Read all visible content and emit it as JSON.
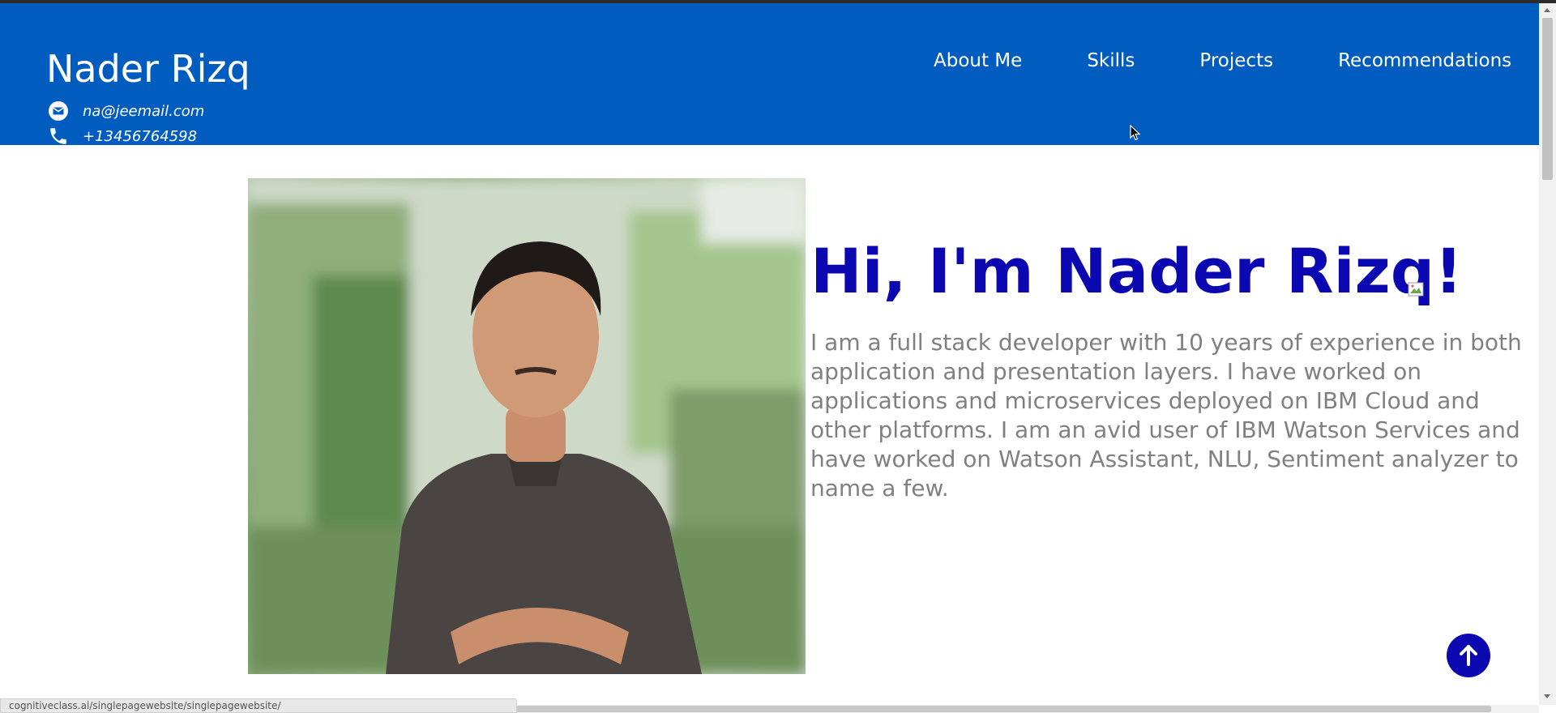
{
  "header": {
    "name": "Nader Rizq",
    "email": "na@jeemail.com",
    "phone": "+13456764598",
    "background_color": "#005cbf"
  },
  "nav": {
    "items": [
      {
        "label": "About Me"
      },
      {
        "label": "Skills"
      },
      {
        "label": "Projects"
      },
      {
        "label": "Recommendations"
      }
    ]
  },
  "hero": {
    "title": "Hi, I'm Nader Rizq!",
    "title_color": "#0b08b2",
    "bio": "I am a full stack developer with 10 years of experience in both application and presentation layers. I have worked on applications and microservices deployed on IBM Cloud and other platforms. I am an avid user of IBM Watson Services and have worked on Watson Assistant, NLU, Sentiment analyzer to name a few.",
    "photo_icon": "profile-photo"
  },
  "back_to_top": {
    "icon": "arrow-up-icon",
    "color": "#0b08b2"
  },
  "status_bar": {
    "url": "cognitiveclass.ai/singlepagewebsite/singlepagewebsite/"
  }
}
